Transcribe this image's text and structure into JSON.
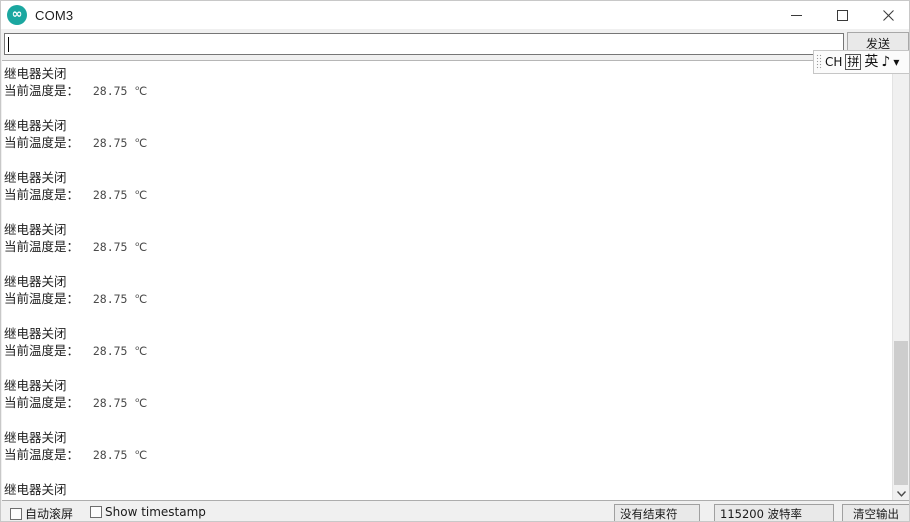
{
  "window": {
    "title": "COM3",
    "app_icon": "arduino-infinity-icon",
    "icon_color": "#1ba7a0",
    "controls": {
      "minimize": "minimize-icon",
      "maximize": "maximize-icon",
      "close": "close-icon"
    }
  },
  "send_row": {
    "input_value": "",
    "input_placeholder": "",
    "send_label": "发送"
  },
  "console": {
    "blocks": [
      {
        "status": "继电器关闭",
        "label": "当前温度是：",
        "value": "28.75 ℃"
      },
      {
        "status": "继电器关闭",
        "label": "当前温度是：",
        "value": "28.75 ℃"
      },
      {
        "status": "继电器关闭",
        "label": "当前温度是：",
        "value": "28.75 ℃"
      },
      {
        "status": "继电器关闭",
        "label": "当前温度是：",
        "value": "28.75 ℃"
      },
      {
        "status": "继电器关闭",
        "label": "当前温度是：",
        "value": "28.75 ℃"
      },
      {
        "status": "继电器关闭",
        "label": "当前温度是：",
        "value": "28.75 ℃"
      },
      {
        "status": "继电器关闭",
        "label": "当前温度是：",
        "value": "28.75 ℃"
      },
      {
        "status": "继电器关闭",
        "label": "当前温度是：",
        "value": "28.75 ℃"
      }
    ],
    "trailing_status": "继电器关闭"
  },
  "scrollbar": {
    "down_arrow": "chevron-down-icon"
  },
  "bottom_bar": {
    "autoscroll_label": "自动滚屏",
    "timestamp_label": "Show timestamp",
    "line_ending": "没有结束符",
    "baud_rate": "115200 波特率",
    "clear_output": "清空输出"
  },
  "ime_bar": {
    "mode": "CH",
    "input_method": "拼",
    "language": "英",
    "sound": "♪",
    "extra": "▾"
  }
}
